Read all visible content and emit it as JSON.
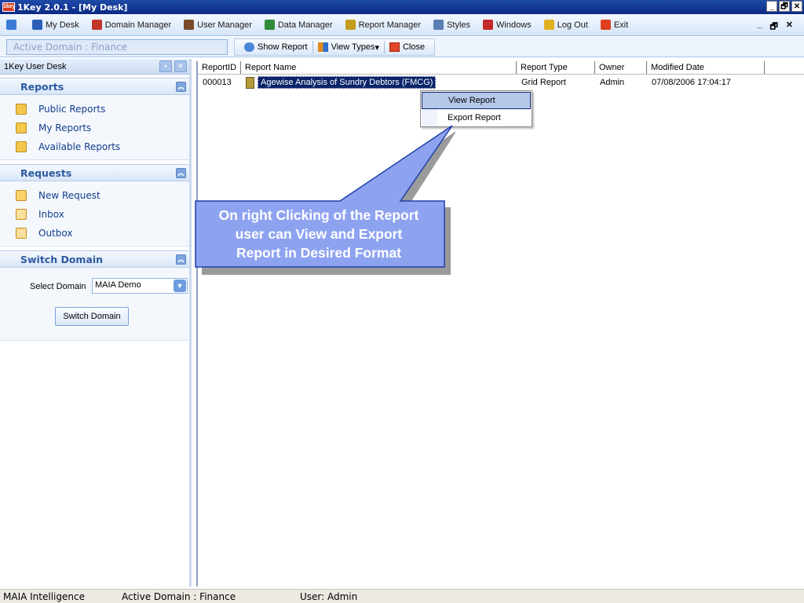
{
  "window": {
    "title": "1Key 2.0.1 - [My Desk]",
    "app_icon_text": "1key"
  },
  "window_controls": [
    "_",
    "🗗",
    "✕"
  ],
  "menu": [
    {
      "label": "",
      "icon": "app-icon",
      "color": "#3a7bd5"
    },
    {
      "label": "My Desk",
      "icon": "desk-icon",
      "color": "#2b5fb5"
    },
    {
      "label": "Domain Manager",
      "icon": "domain-icon",
      "color": "#c5362a"
    },
    {
      "label": "User Manager",
      "icon": "user-icon",
      "color": "#7a4a2a"
    },
    {
      "label": "Data Manager",
      "icon": "data-icon",
      "color": "#2f8a3a"
    },
    {
      "label": "Report Manager",
      "icon": "report-icon",
      "color": "#c59b1c"
    },
    {
      "label": "Styles",
      "icon": "styles-icon",
      "color": "#5c7fb5"
    },
    {
      "label": "Windows",
      "icon": "windows-icon",
      "color": "#c52a2a"
    },
    {
      "label": "Log Out",
      "icon": "logout-icon",
      "color": "#e0b020"
    },
    {
      "label": "Exit",
      "icon": "exit-icon",
      "color": "#e04020"
    }
  ],
  "mdi_controls": [
    "_",
    "🗗",
    "✕"
  ],
  "toolbar": {
    "active_domain": "Active Domain : Finance",
    "show_report": "Show Report",
    "view_types": "View Types",
    "view_types_arrow": "▾",
    "close": "Close"
  },
  "left_panel": {
    "title": "1Key User Desk",
    "reports": {
      "header": "Reports",
      "items": [
        "Public Reports",
        "My Reports",
        "Available Reports"
      ]
    },
    "requests": {
      "header": "Requests",
      "items": [
        "New Request",
        "Inbox",
        "Outbox"
      ]
    },
    "switch_domain": {
      "header": "Switch Domain",
      "select_label": "Select Domain",
      "selected_value": "MAIA Demo",
      "button": "Switch Domain"
    }
  },
  "grid": {
    "columns": [
      "ReportID",
      "Report Name",
      "Report Type",
      "Owner",
      "Modified Date"
    ],
    "rows": [
      {
        "id": "000013",
        "name": "Agewise Analysis of Sundry Debtors (FMCG)",
        "type": "Grid Report",
        "owner": "Admin",
        "modified": "07/08/2006 17:04:17"
      }
    ]
  },
  "context_menu": {
    "items": [
      "View Report",
      "Export Report"
    ]
  },
  "callout": {
    "lines": [
      "On right Clicking of the Report",
      "user can View and Export",
      "Report in Desired Format"
    ],
    "fill_color": "#8ea3f0",
    "border_color": "#1e3fa8"
  },
  "status_bar": {
    "company": "MAIA Intelligence",
    "domain": "Active Domain : Finance",
    "user": "User: Admin"
  }
}
